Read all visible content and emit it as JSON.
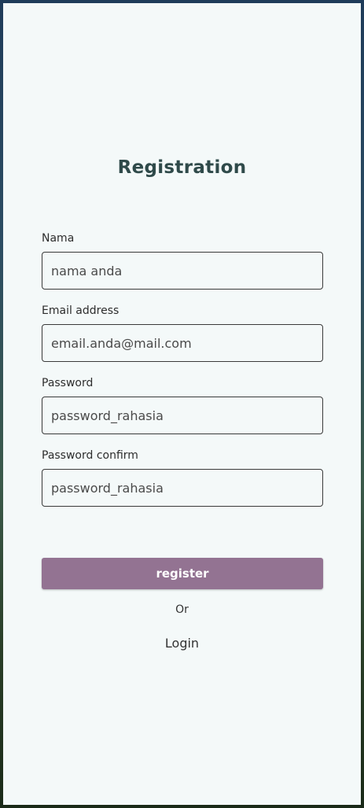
{
  "page": {
    "title": "Registration"
  },
  "form": {
    "name": {
      "label": "Nama",
      "placeholder": "nama anda"
    },
    "email": {
      "label": "Email address",
      "placeholder": "email.anda@mail.com"
    },
    "password": {
      "label": "Password",
      "placeholder": "password_rahasia"
    },
    "password_confirm": {
      "label": "Password confirm",
      "placeholder": "password_rahasia"
    },
    "register_label": "register"
  },
  "footer": {
    "or_text": "Or",
    "login_label": "Login"
  },
  "colors": {
    "accent": "#937392",
    "title": "#2f4a4a",
    "panel_background": "#f4f9f9"
  }
}
